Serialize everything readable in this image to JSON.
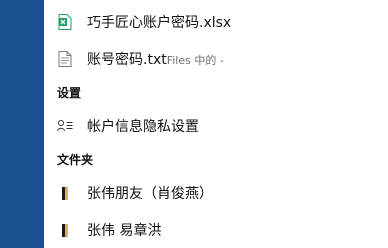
{
  "results": {
    "top_items": [
      {
        "label": "巧手匠心账户密码.xlsx",
        "icon": "excel-file-icon"
      },
      {
        "label": "账号密码.txt",
        "sub": "Files 中的 -",
        "icon": "text-file-icon"
      }
    ],
    "settings_header": "设置",
    "settings_items": [
      {
        "label": "帐户信息隐私设置",
        "icon": "account-info-icon"
      }
    ],
    "folders_header": "文件夹",
    "folder_items": [
      {
        "label": "张伟朋友（肖俊燕）",
        "icon": "folder-icon"
      },
      {
        "label": "张伟 易章洪",
        "icon": "folder-icon"
      }
    ]
  },
  "colors": {
    "accent_strip": "#1c4f8f",
    "excel_green": "#21a366"
  }
}
